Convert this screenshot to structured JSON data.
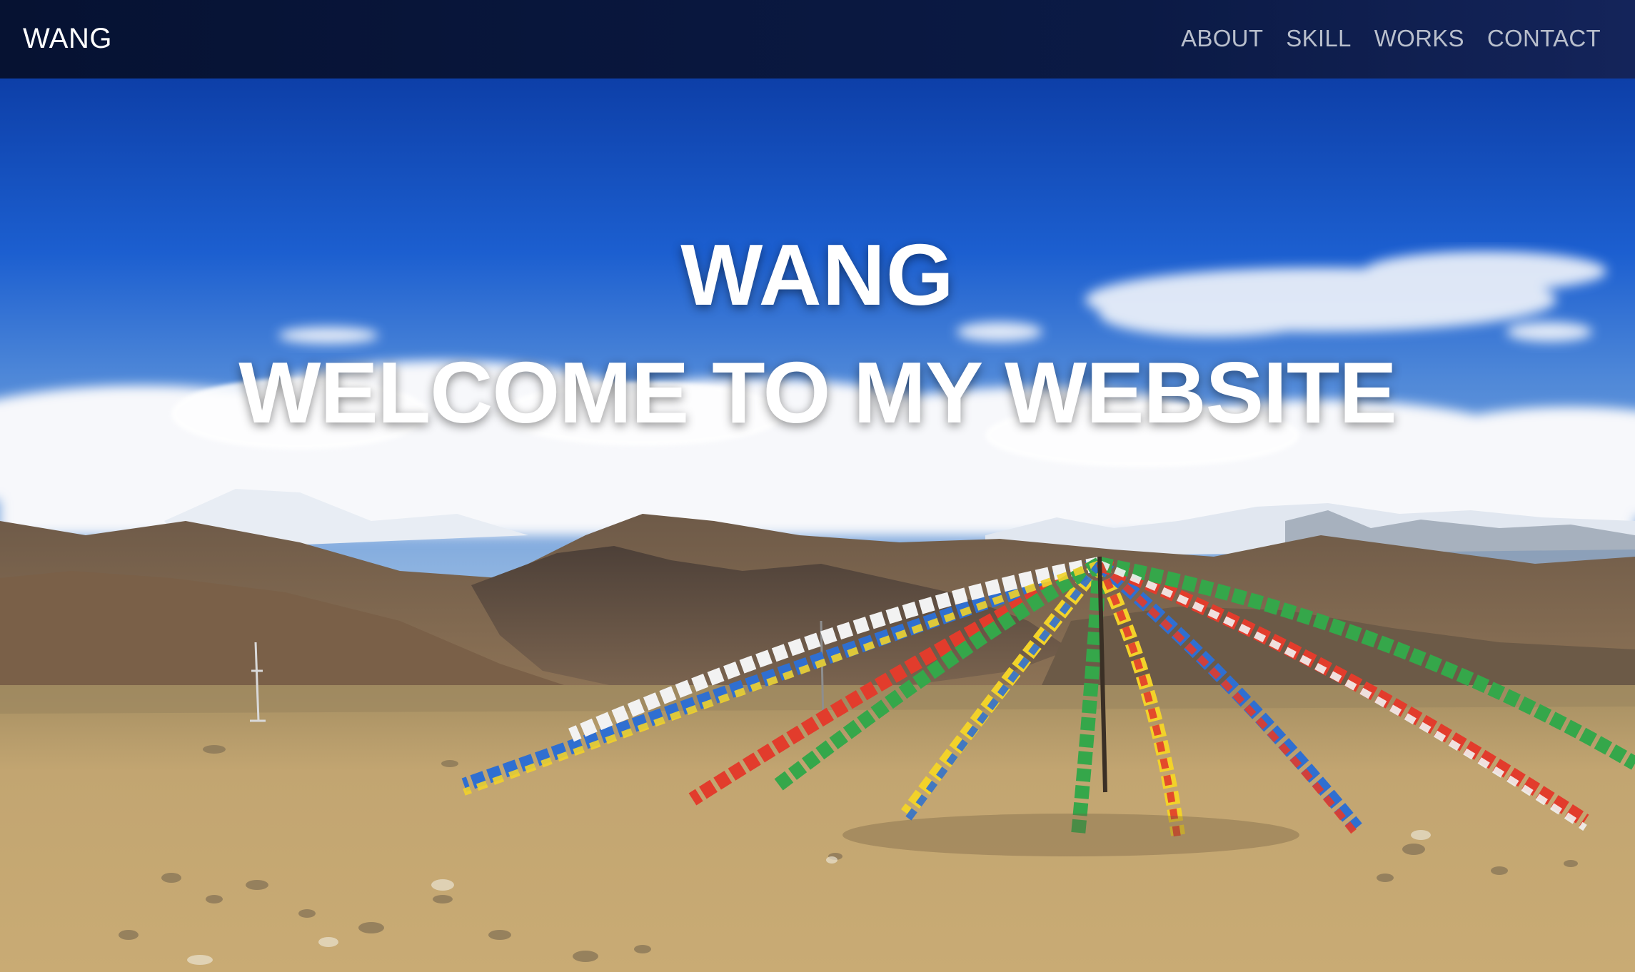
{
  "navbar": {
    "brand": "WANG",
    "links": [
      "ABOUT",
      "SKILL",
      "WORKS",
      "CONTACT"
    ]
  },
  "hero": {
    "name": "WANG",
    "tagline": "WELCOME TO MY WEBSITE",
    "background": "landscape-photo-prayer-flags-mountains"
  },
  "colors": {
    "navbar_bg": "#061232",
    "nav_link": "#b9bfcc",
    "hero_text": "#ffffff",
    "sky": "#1e63d6"
  }
}
